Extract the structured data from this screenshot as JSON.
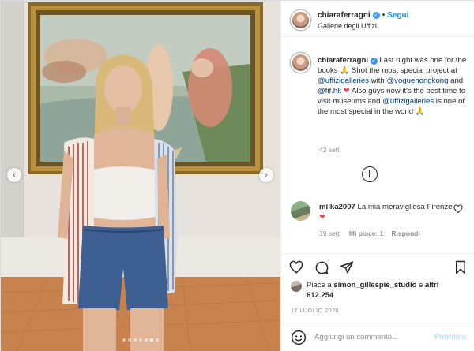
{
  "header": {
    "username": "chiaraferragni",
    "separator": "•",
    "follow_label": "Segui",
    "location": "Gallerie degli Uffizi",
    "verified_icon": "verified-badge-icon"
  },
  "media": {
    "description": "",
    "prev_icon": "chevron-left-icon",
    "next_icon": "chevron-right-icon",
    "slides": 7,
    "active_slide": 6
  },
  "caption": {
    "username": "chiaraferragni",
    "parts": {
      "p1": "Last night was one for the books ",
      "e1": "🙏",
      "p2": " Shot the most special project at ",
      "m1": "@uffizigalleries",
      "p3": " with ",
      "m2": "@voguehongkong",
      "p4": " and ",
      "m3": "@fif.hk",
      "e2": "❤",
      "p5": " Also guys now it's the best time to visit museums and ",
      "m4": "@uffizigalleries",
      "p6": " is one of the most special in the world ",
      "e3": "🙏"
    },
    "time": "42 sett."
  },
  "load_more_icon": "plus-circle-icon",
  "comment": {
    "username": "milka2007",
    "text": "La mia meravigliosa Firenze ",
    "emoji": "❤",
    "time": "39 sett.",
    "likes": "Mi piace: 1",
    "reply": "Rispondi"
  },
  "actions": {
    "like_icon": "heart-icon",
    "comment_icon": "comment-icon",
    "share_icon": "paper-plane-icon",
    "save_icon": "bookmark-icon"
  },
  "likes": {
    "prefix": "Piace a ",
    "user": "simon_gillespie_studio",
    "middle": " e ",
    "others_prefix": "altri ",
    "count": "612.254"
  },
  "date": "17 LUGLIO 2020",
  "add_comment": {
    "placeholder": "Aggiungi un commento...",
    "publish_label": "Pubblica",
    "emoji_icon": "smiley-icon"
  },
  "colors": {
    "accent": "#0095f6",
    "verified": "#3897f0",
    "heart": "#ed4956",
    "muted": "#8e8e8e",
    "publish_disabled": "#b2dffc"
  }
}
